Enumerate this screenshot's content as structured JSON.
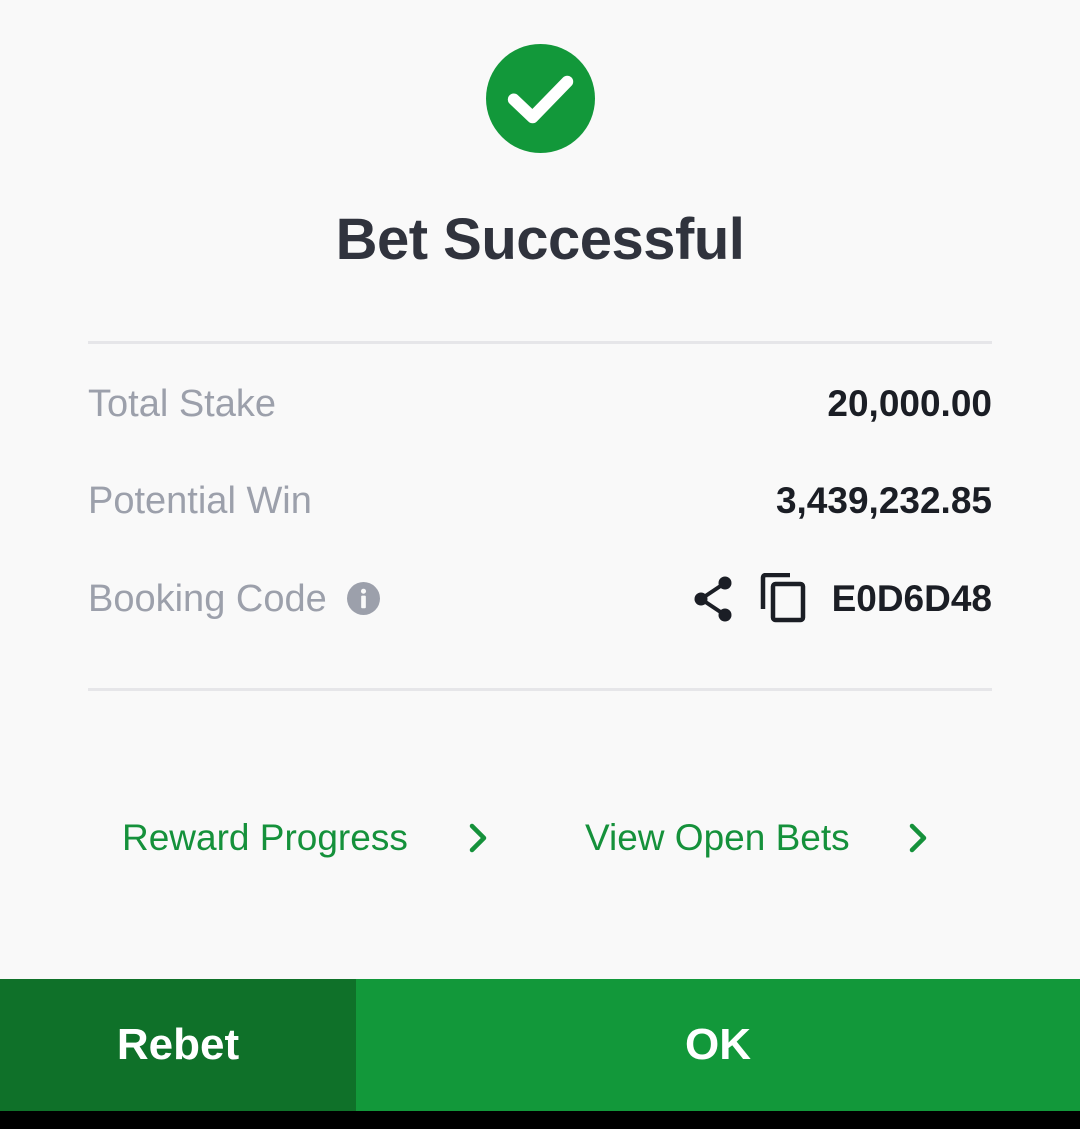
{
  "dialog": {
    "title": "Bet Successful",
    "rows": {
      "total_stake": {
        "label": "Total Stake",
        "value": "20,000.00"
      },
      "potential_win": {
        "label": "Potential Win",
        "value": "3,439,232.85"
      },
      "booking_code": {
        "label": "Booking Code",
        "value": "E0D6D48"
      }
    },
    "links": {
      "reward_progress": "Reward Progress",
      "view_open_bets": "View Open Bets"
    },
    "buttons": {
      "rebet": "Rebet",
      "ok": "OK"
    },
    "icons": {
      "status": "check-circle-icon",
      "info": "info-icon",
      "share": "share-icon",
      "copy": "copy-icon",
      "chevron": "chevron-right-icon"
    },
    "colors": {
      "success_green": "#12983a",
      "dark_green": "#0f7129",
      "link_green": "#15913b",
      "title_text": "#30333d",
      "label_text": "#9ca0ab",
      "value_text": "#1b1e25",
      "background": "#f9f9f9"
    }
  }
}
